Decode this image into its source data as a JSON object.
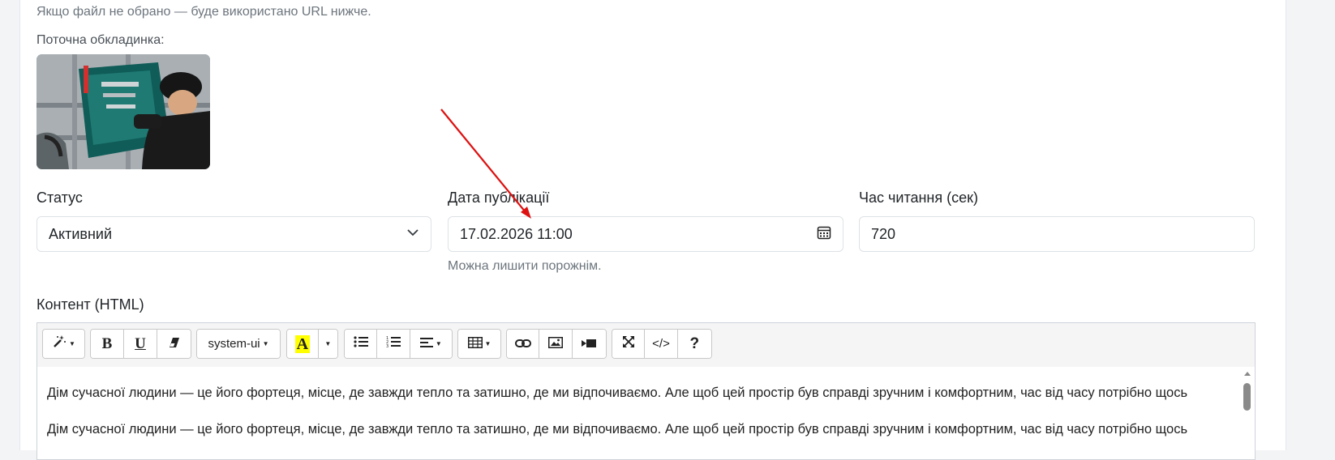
{
  "form": {
    "url_hint": "Якщо файл не обрано — буде використано URL нижче.",
    "cover_label": "Поточна обкладинка:",
    "cover_image_alt": "Поточна обкладинка",
    "status": {
      "label": "Статус",
      "value": "Активний"
    },
    "publish_date": {
      "label": "Дата публікації",
      "value": "17.02.2026 11:00",
      "help": "Можна лишити порожнім."
    },
    "read_time": {
      "label": "Час читання (сек)",
      "value": "720"
    },
    "content_label": "Контент (HTML)"
  },
  "editor": {
    "toolbar": {
      "style_icon": "magic-wand-icon",
      "bold": "B",
      "underline": "U",
      "eraser_icon": "eraser-icon",
      "font_name": "system-ui",
      "highlight": "A",
      "highlight_color": "#ffff00",
      "ul_icon": "unordered-list-icon",
      "ol_icon": "ordered-list-icon",
      "align_icon": "align-left-icon",
      "table_icon": "table-icon",
      "link_icon": "link-icon",
      "picture_icon": "picture-icon",
      "video_icon": "video-icon",
      "fullscreen_icon": "fullscreen-icon",
      "code": "</>",
      "help": "?"
    },
    "paragraphs": [
      "Дім сучасної людини — це його фортеця, місце, де завжди тепло та затишно, де ми відпочиваємо. Але щоб цей простір був справді зручним і комфортним, час від часу потрібно щось",
      "Дім сучасної людини — це його фортеця, місце, де завжди тепло та затишно, де ми відпочиваємо. Але щоб цей простір був справді зручним і комфортним, час від часу потрібно щось"
    ]
  },
  "colors": {
    "annotation_arrow": "#dd1111",
    "accent_highlight": "#ffff00"
  }
}
